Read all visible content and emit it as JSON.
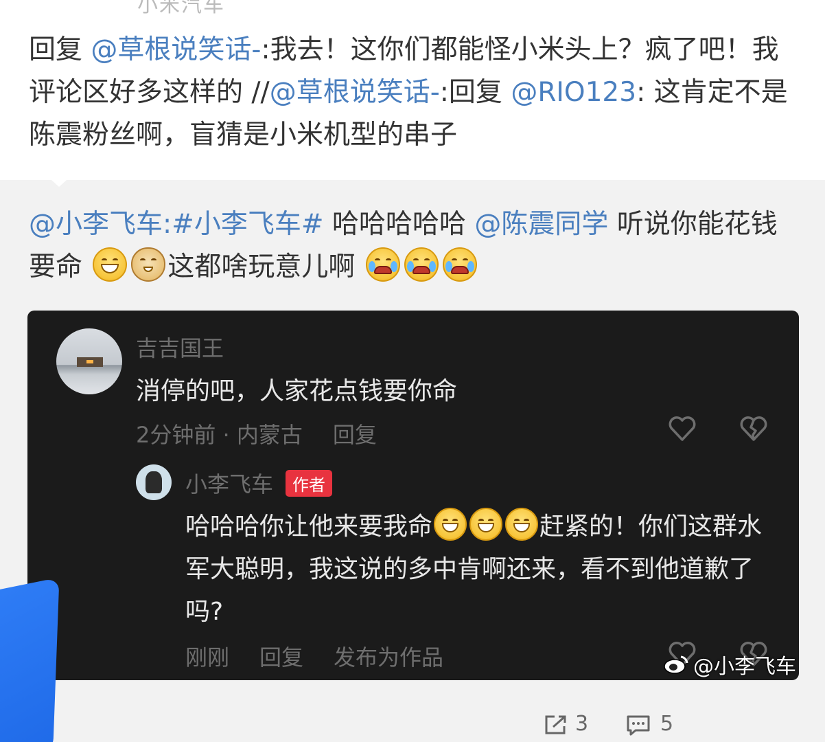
{
  "reply_post": {
    "clipped_top_text": "小米汽车",
    "segments": [
      {
        "text": "回复 ",
        "link": false
      },
      {
        "text": "@草根说笑话-",
        "link": true
      },
      {
        "text": ":我去！这你们都能怪小米头上？疯了吧！我评论区好多这样的 //",
        "link": false
      },
      {
        "text": "@草根说笑话-",
        "link": true
      },
      {
        "text": ":回复 ",
        "link": false
      },
      {
        "text": "@RIO123",
        "link": true
      },
      {
        "text": ": 这肯定不是陈震粉丝啊，盲猜是小米机型的串子",
        "link": false
      }
    ]
  },
  "original_post": {
    "mention_author": "@小李飞车",
    "colon": ":",
    "hashtag": "#小李飞车#",
    "laugh": " 哈哈哈哈哈 ",
    "mention_chen": "@陈震同学",
    "text_a": " 听说你能花钱要命",
    "text_b": "这都啥玩意儿啊"
  },
  "comment": {
    "username": "吉吉国王",
    "content": "消停的吧，人家花点钱要你命",
    "time_location": "2分钟前 · 内蒙古",
    "reply_label": "回复"
  },
  "author_reply": {
    "username": "小李飞车",
    "badge": "作者",
    "text_a": "哈哈哈你让他来要我命",
    "text_b": "赶紧的！你们这群水军大聪明，我这说的多中肯啊还来，看不到他道歉了吗?",
    "time": "刚刚",
    "reply_label": "回复",
    "publish_label": "发布为作品"
  },
  "watermark": {
    "text": "@小李飞车"
  },
  "stats": {
    "shares": "3",
    "comments": "5"
  },
  "colors": {
    "link": "#4a7fbf",
    "badge": "#e8333f",
    "card_bg": "#1b1b1b"
  }
}
